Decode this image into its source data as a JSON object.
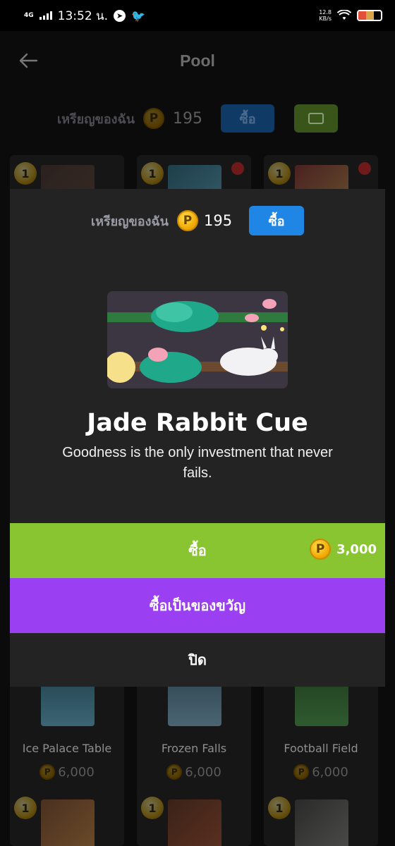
{
  "status": {
    "time": "13:52 น.",
    "network": "4G",
    "speed_value": "12.8",
    "speed_unit": "KB/s"
  },
  "app": {
    "title": "Pool",
    "my_coins_label": "เหรียญของฉัน",
    "coin_count": "195",
    "buy_label": "ซื้อ"
  },
  "grid": {
    "badge": "1",
    "cards": [
      {
        "name": "",
        "price": ""
      },
      {
        "name": "",
        "price": ""
      },
      {
        "name": "",
        "price": ""
      },
      {
        "name": "Ice Palace Table",
        "price": "6,000"
      },
      {
        "name": "Frozen Falls",
        "price": "6,000"
      },
      {
        "name": "Football Field",
        "price": "6,000"
      },
      {
        "name": "",
        "price": ""
      },
      {
        "name": "",
        "price": ""
      },
      {
        "name": "",
        "price": ""
      }
    ]
  },
  "modal": {
    "my_coins_label": "เหรียญของฉัน",
    "coin_count": "195",
    "buy_label": "ซื้อ",
    "item_title": "Jade Rabbit Cue",
    "item_description": "Goodness is the only investment that never fails.",
    "purchase_label": "ซื้อ",
    "price": "3,000",
    "gift_label": "ซื้อเป็นของขวัญ",
    "close_label": "ปิด",
    "coin_symbol": "P"
  },
  "colors": {
    "buy_blue": "#1f86e6",
    "purchase_green": "#89c530",
    "gift_purple": "#9b3ff2",
    "modal_bg": "#232323"
  }
}
